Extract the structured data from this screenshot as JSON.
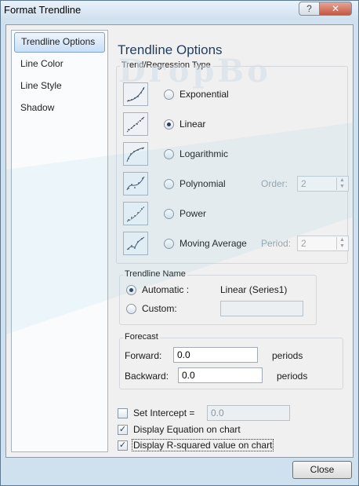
{
  "window": {
    "title": "Format Trendline",
    "help_glyph": "?",
    "close_glyph": "✕",
    "watermark": "DropBo"
  },
  "nav": {
    "items": [
      {
        "label": "Trendline Options",
        "selected": true
      },
      {
        "label": "Line Color",
        "selected": false
      },
      {
        "label": "Line Style",
        "selected": false
      },
      {
        "label": "Shadow",
        "selected": false
      }
    ]
  },
  "panel": {
    "title": "Trendline Options",
    "trend_group_label": "Trend/Regression Type",
    "types": [
      {
        "label": "Exponential",
        "selected": false,
        "icon": "exponential-icon"
      },
      {
        "label": "Linear",
        "selected": true,
        "icon": "linear-icon"
      },
      {
        "label": "Logarithmic",
        "selected": false,
        "icon": "logarithmic-icon"
      },
      {
        "label": "Polynomial",
        "selected": false,
        "icon": "polynomial-icon",
        "param_label": "Order:",
        "param_value": "2"
      },
      {
        "label": "Power",
        "selected": false,
        "icon": "power-icon"
      },
      {
        "label": "Moving Average",
        "selected": false,
        "icon": "moving-average-icon",
        "param_label": "Period:",
        "param_value": "2"
      }
    ],
    "name_group_label": "Trendline Name",
    "name_automatic_label": "Automatic :",
    "name_automatic_value": "Linear (Series1)",
    "name_custom_label": "Custom:",
    "name_custom_value": "",
    "name_selected": "automatic",
    "forecast_group_label": "Forecast",
    "forward_label": "Forward:",
    "forward_value": "0.0",
    "forward_unit": "periods",
    "backward_label": "Backward:",
    "backward_value": "0.0",
    "backward_unit": "periods",
    "intercept_label": "Set Intercept =",
    "intercept_value": "0.0",
    "intercept_checked": false,
    "display_equation_label": "Display Equation on chart",
    "display_equation_checked": true,
    "display_rsquared_label": "Display R-squared value on chart",
    "display_rsquared_checked": true
  },
  "footer": {
    "close_label": "Close"
  },
  "colors": {
    "accent": "#1f3d5d",
    "nav_selected": "#c9def5",
    "window_frame": "#cfe0ef"
  }
}
